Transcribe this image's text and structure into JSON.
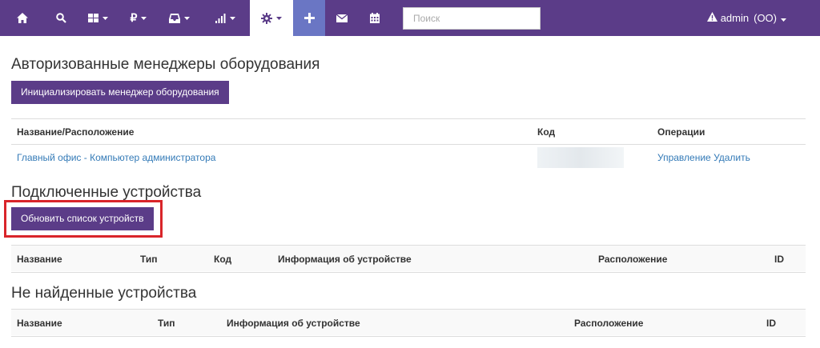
{
  "nav": {
    "search_placeholder": "Поиск",
    "user_name": "admin",
    "user_org": "(OO)"
  },
  "authorized": {
    "title": "Авторизованные менеджеры оборудования",
    "init_button": "Инициализировать менеджер оборудования",
    "columns": [
      "Название/Расположение",
      "Код",
      "Операции"
    ],
    "rows": [
      {
        "name": "Главный офис - Компьютер администратора",
        "code": "",
        "op_manage": "Управление",
        "op_delete": "Удалить"
      }
    ]
  },
  "connected": {
    "title": "Подключенные устройства",
    "refresh_button": "Обновить список устройств",
    "columns": [
      "Название",
      "Тип",
      "Код",
      "Информация об устройстве",
      "Расположение",
      "ID"
    ]
  },
  "not_found": {
    "title": "Не найденные устройства",
    "columns": [
      "Название",
      "Тип",
      "Информация об устройстве",
      "Расположение",
      "ID"
    ]
  },
  "colors": {
    "navbar": "#5b3c88",
    "highlight": "#d9252a",
    "link": "#337ab7"
  }
}
